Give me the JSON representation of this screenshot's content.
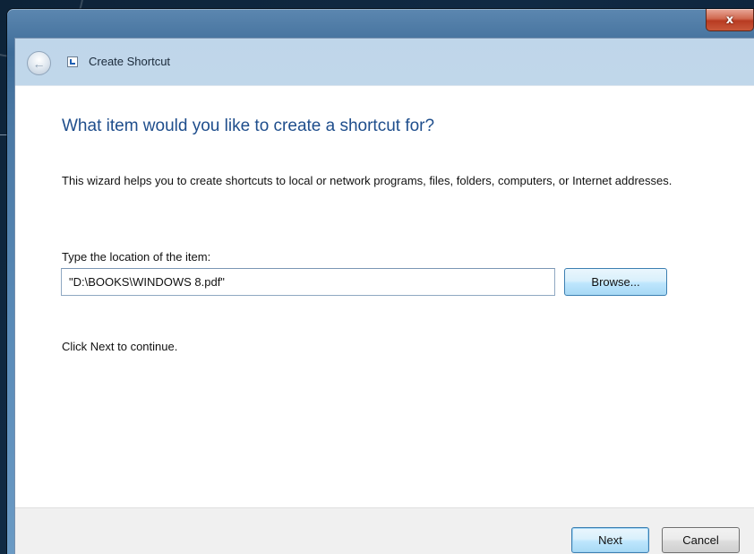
{
  "window": {
    "title": "Create Shortcut",
    "close_label": "x"
  },
  "wizard": {
    "heading": "What item would you like to create a shortcut for?",
    "description": "This wizard helps you to create shortcuts to local or network programs, files, folders, computers, or Internet addresses.",
    "location_label": "Type the location of the item:",
    "location_value": "\"D:\\BOOKS\\WINDOWS 8.pdf\"",
    "browse_label": "Browse...",
    "continue_text": "Click Next to continue."
  },
  "footer": {
    "next_label": "Next",
    "cancel_label": "Cancel"
  },
  "icons": {
    "back": "back-arrow-icon",
    "app": "shortcut-icon",
    "close": "close-icon"
  },
  "colors": {
    "heading": "#1f4e8c",
    "close_button": "#c8583a",
    "default_button": "#bee6fd"
  }
}
